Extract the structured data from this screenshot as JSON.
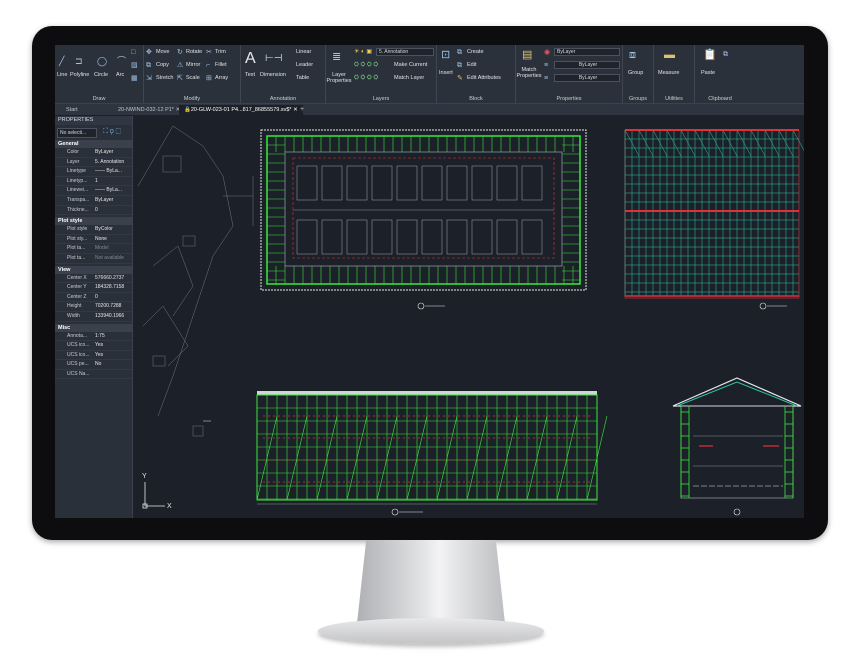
{
  "ribbon": {
    "draw": {
      "title": "Draw",
      "line": "Line",
      "polyline": "Polyline",
      "circle": "Circle",
      "arc": "Arc"
    },
    "modify": {
      "title": "Modify",
      "move": "Move",
      "rotate": "Rotate",
      "trim": "Trim",
      "copy": "Copy",
      "mirror": "Mirror",
      "fillet": "Fillet",
      "stretch": "Stretch",
      "scale": "Scale",
      "array": "Array"
    },
    "annotation": {
      "title": "Annotation",
      "text": "Text",
      "dimension": "Dimension",
      "linear": "Linear",
      "leader": "Leader",
      "table": "Table"
    },
    "layers": {
      "title": "Layers",
      "layer_properties": "Layer Properties",
      "layer_combo": "5. Annotation",
      "make_current": "Make Current",
      "match_layer": "Match Layer"
    },
    "block": {
      "title": "Block",
      "insert": "Insert",
      "create": "Create",
      "edit": "Edit",
      "edit_attributes": "Edit Attributes"
    },
    "properties": {
      "title": "Properties",
      "match_properties": "Match Properties",
      "color": "ByLayer",
      "linetype": "ByLayer",
      "lineweight": "ByLayer"
    },
    "groups": {
      "title": "Groups",
      "group": "Group"
    },
    "utilities": {
      "title": "Utilities",
      "measure": "Measure"
    },
    "clipboard": {
      "title": "Clipboard",
      "paste": "Paste"
    }
  },
  "tabs": [
    {
      "label": "Start"
    },
    {
      "label": "20-NWIND-032-12 P1*"
    },
    {
      "label": "20-GLW-023-01 P4...817_86855579.sv$*"
    }
  ],
  "properties_panel": {
    "title": "PROPERTIES",
    "selection": "No selecti...",
    "sections": [
      {
        "title": "General",
        "rows": [
          {
            "k": "Color",
            "v": "ByLayer"
          },
          {
            "k": "Layer",
            "v": "5. Annotation"
          },
          {
            "k": "Linetype",
            "v": "—— ByLa..."
          },
          {
            "k": "Linetyp...",
            "v": "1"
          },
          {
            "k": "Linewei...",
            "v": "—— ByLa..."
          },
          {
            "k": "Transpa...",
            "v": "ByLayer"
          },
          {
            "k": "Thickne...",
            "v": "0"
          }
        ]
      },
      {
        "title": "Plot style",
        "rows": [
          {
            "k": "Plot style",
            "v": "ByColor"
          },
          {
            "k": "Plot sty...",
            "v": "None"
          },
          {
            "k": "Plot ta...",
            "v": "Model"
          },
          {
            "k": "Plot ta...",
            "v": "Not available"
          }
        ]
      },
      {
        "title": "View",
        "rows": [
          {
            "k": "Center X",
            "v": "576660.2737"
          },
          {
            "k": "Center Y",
            "v": "184328.7158"
          },
          {
            "k": "Center Z",
            "v": "0"
          },
          {
            "k": "Height",
            "v": "70200.7288"
          },
          {
            "k": "Width",
            "v": "133940.1966"
          }
        ]
      },
      {
        "title": "Misc",
        "rows": [
          {
            "k": "Annota...",
            "v": "1:75"
          },
          {
            "k": "UCS ico...",
            "v": "Yes"
          },
          {
            "k": "UCS ico...",
            "v": "Yes"
          },
          {
            "k": "UCS pe...",
            "v": "No"
          },
          {
            "k": "UCS Na...",
            "v": ""
          }
        ]
      }
    ]
  },
  "drawing": {
    "ucs_y": "Y",
    "ucs_x": "X"
  },
  "colors": {
    "scaffold_green": "#39e83a",
    "teal": "#2ec4a8",
    "red": "#e0303a",
    "grey_line": "#8a919c",
    "white_line": "#e8e8e8"
  }
}
